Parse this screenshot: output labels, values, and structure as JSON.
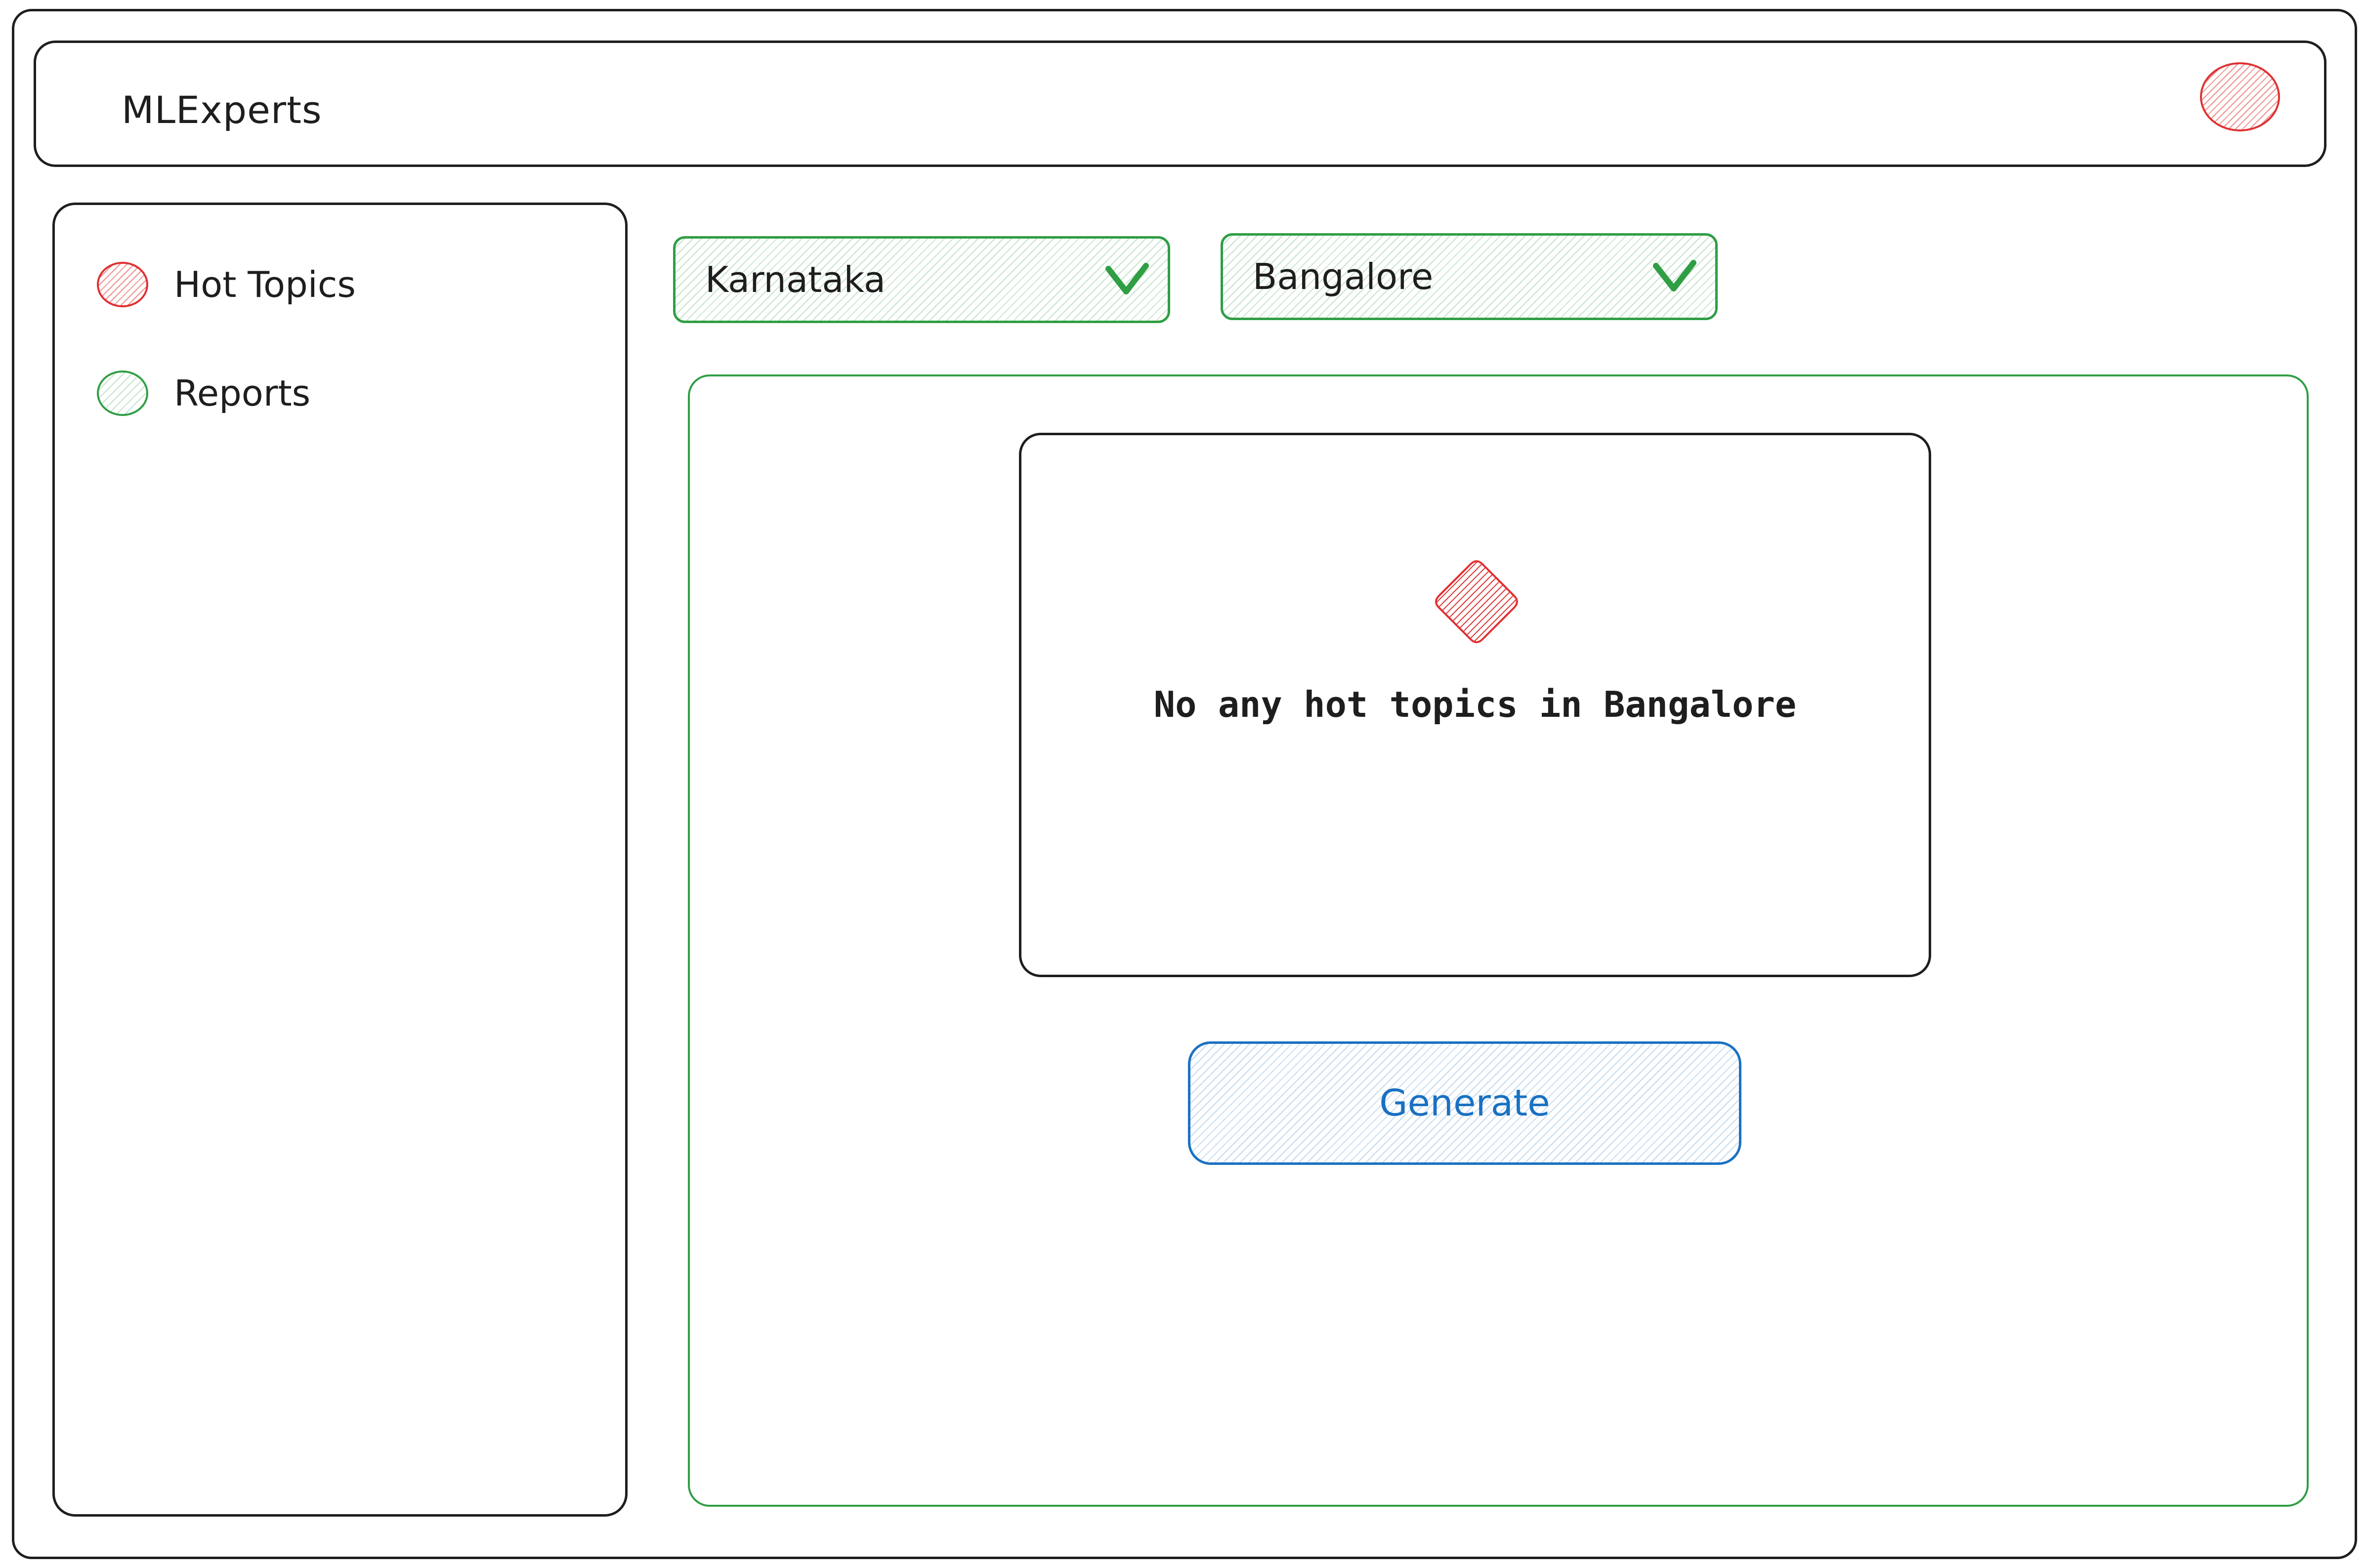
{
  "header": {
    "app_title": "MLExperts",
    "avatar_icon": "user-avatar-circle"
  },
  "sidebar": {
    "items": [
      {
        "label": "Hot Topics",
        "icon": "red-circle-icon",
        "color": "#e03131"
      },
      {
        "label": "Reports",
        "icon": "green-circle-icon",
        "color": "#2f9e44"
      }
    ]
  },
  "filters": {
    "state": {
      "value": "Karnataka",
      "icon": "chevron-down-icon"
    },
    "city": {
      "value": "Bangalore",
      "icon": "chevron-down-icon"
    }
  },
  "main": {
    "empty_state": {
      "icon": "diamond-icon",
      "message": "No any hot topics in Bangalore"
    },
    "generate_label": "Generate"
  },
  "colors": {
    "accent_green": "#2f9e44",
    "accent_red": "#e03131",
    "accent_blue": "#1971c2",
    "ink": "#1e1e1e"
  }
}
